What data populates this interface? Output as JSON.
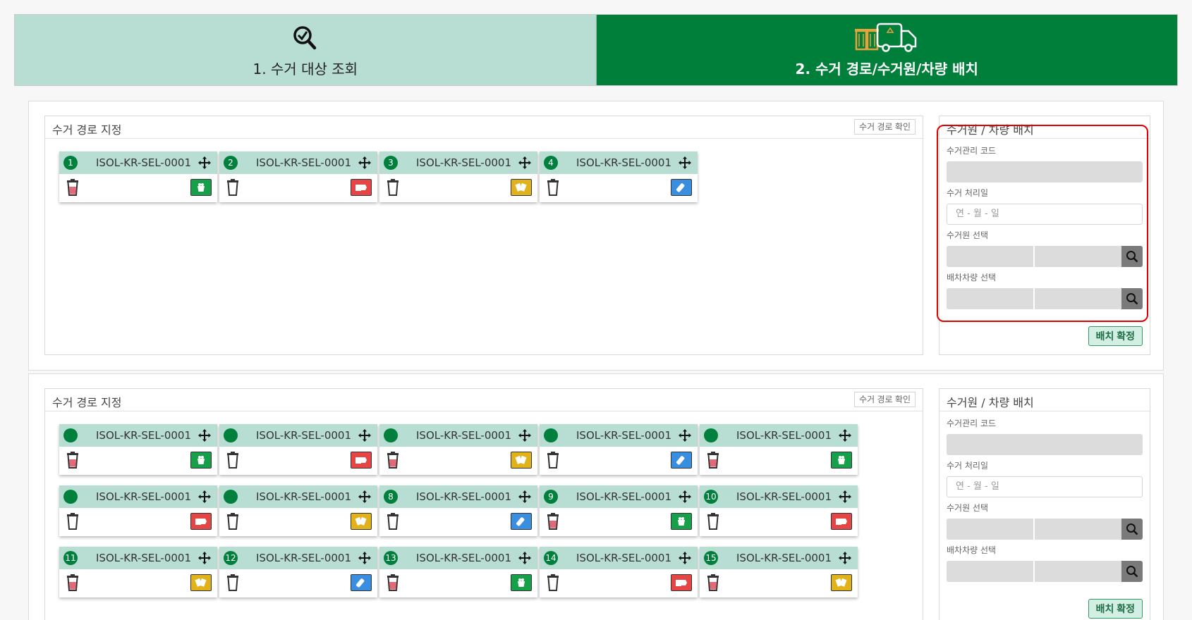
{
  "steps": [
    {
      "label": "1. 수거 대상 조회",
      "icon": "search-check-icon",
      "active": false
    },
    {
      "label": "2. 수거 경로/수거원/차량 배치",
      "icon": "truck-bins-icon",
      "active": true
    }
  ],
  "colors": {
    "brand_green": "#007f3a",
    "light_green": "#b8ddd2",
    "highlight_red": "#e00000"
  },
  "panels": [
    {
      "route_title": "수거 경로 지정",
      "route_confirm_label": "수거 경로 확인",
      "cards": [
        {
          "badge": "1",
          "code": "ISOL-KR-SEL-0001",
          "bin": "filled",
          "type": "green"
        },
        {
          "badge": "2",
          "code": "ISOL-KR-SEL-0001",
          "bin": "empty",
          "type": "red"
        },
        {
          "badge": "3",
          "code": "ISOL-KR-SEL-0001",
          "bin": "empty",
          "type": "yellow"
        },
        {
          "badge": "4",
          "code": "ISOL-KR-SEL-0001",
          "bin": "empty",
          "type": "blue"
        }
      ],
      "side": {
        "title": "수거원 / 차량 배치",
        "code_label": "수거관리 코드",
        "date_label": "수거 처리일",
        "date_placeholder": "연 - 월 - 일",
        "worker_label": "수거원 선택",
        "vehicle_label": "배차차량 선택",
        "confirm_label": "배치 확정"
      }
    },
    {
      "route_title": "수거 경로 지정",
      "route_confirm_label": "수거 경로 확인",
      "cards": [
        {
          "badge": "",
          "code": "ISOL-KR-SEL-0001",
          "bin": "filled",
          "type": "green"
        },
        {
          "badge": "",
          "code": "ISOL-KR-SEL-0001",
          "bin": "empty",
          "type": "red"
        },
        {
          "badge": "",
          "code": "ISOL-KR-SEL-0001",
          "bin": "filled",
          "type": "yellow"
        },
        {
          "badge": "",
          "code": "ISOL-KR-SEL-0001",
          "bin": "empty",
          "type": "blue"
        },
        {
          "badge": "",
          "code": "ISOL-KR-SEL-0001",
          "bin": "filled",
          "type": "green"
        },
        {
          "badge": "",
          "code": "ISOL-KR-SEL-0001",
          "bin": "empty",
          "type": "red"
        },
        {
          "badge": "",
          "code": "ISOL-KR-SEL-0001",
          "bin": "empty",
          "type": "yellow"
        },
        {
          "badge": "8",
          "code": "ISOL-KR-SEL-0001",
          "bin": "empty",
          "type": "blue"
        },
        {
          "badge": "9",
          "code": "ISOL-KR-SEL-0001",
          "bin": "filled",
          "type": "green"
        },
        {
          "badge": "10",
          "code": "ISOL-KR-SEL-0001",
          "bin": "empty",
          "type": "red"
        },
        {
          "badge": "11",
          "code": "ISOL-KR-SEL-0001",
          "bin": "filled",
          "type": "yellow"
        },
        {
          "badge": "12",
          "code": "ISOL-KR-SEL-0001",
          "bin": "empty",
          "type": "blue"
        },
        {
          "badge": "13",
          "code": "ISOL-KR-SEL-0001",
          "bin": "filled",
          "type": "green"
        },
        {
          "badge": "14",
          "code": "ISOL-KR-SEL-0001",
          "bin": "empty",
          "type": "red"
        },
        {
          "badge": "15",
          "code": "ISOL-KR-SEL-0001",
          "bin": "filled",
          "type": "yellow"
        }
      ],
      "side": {
        "title": "수거원 / 차량 배치",
        "code_label": "수거관리 코드",
        "date_label": "수거 처리일",
        "date_placeholder": "연 - 월 - 일",
        "worker_label": "수거원 선택",
        "vehicle_label": "배차차량 선택",
        "confirm_label": "배치 확정"
      }
    }
  ]
}
